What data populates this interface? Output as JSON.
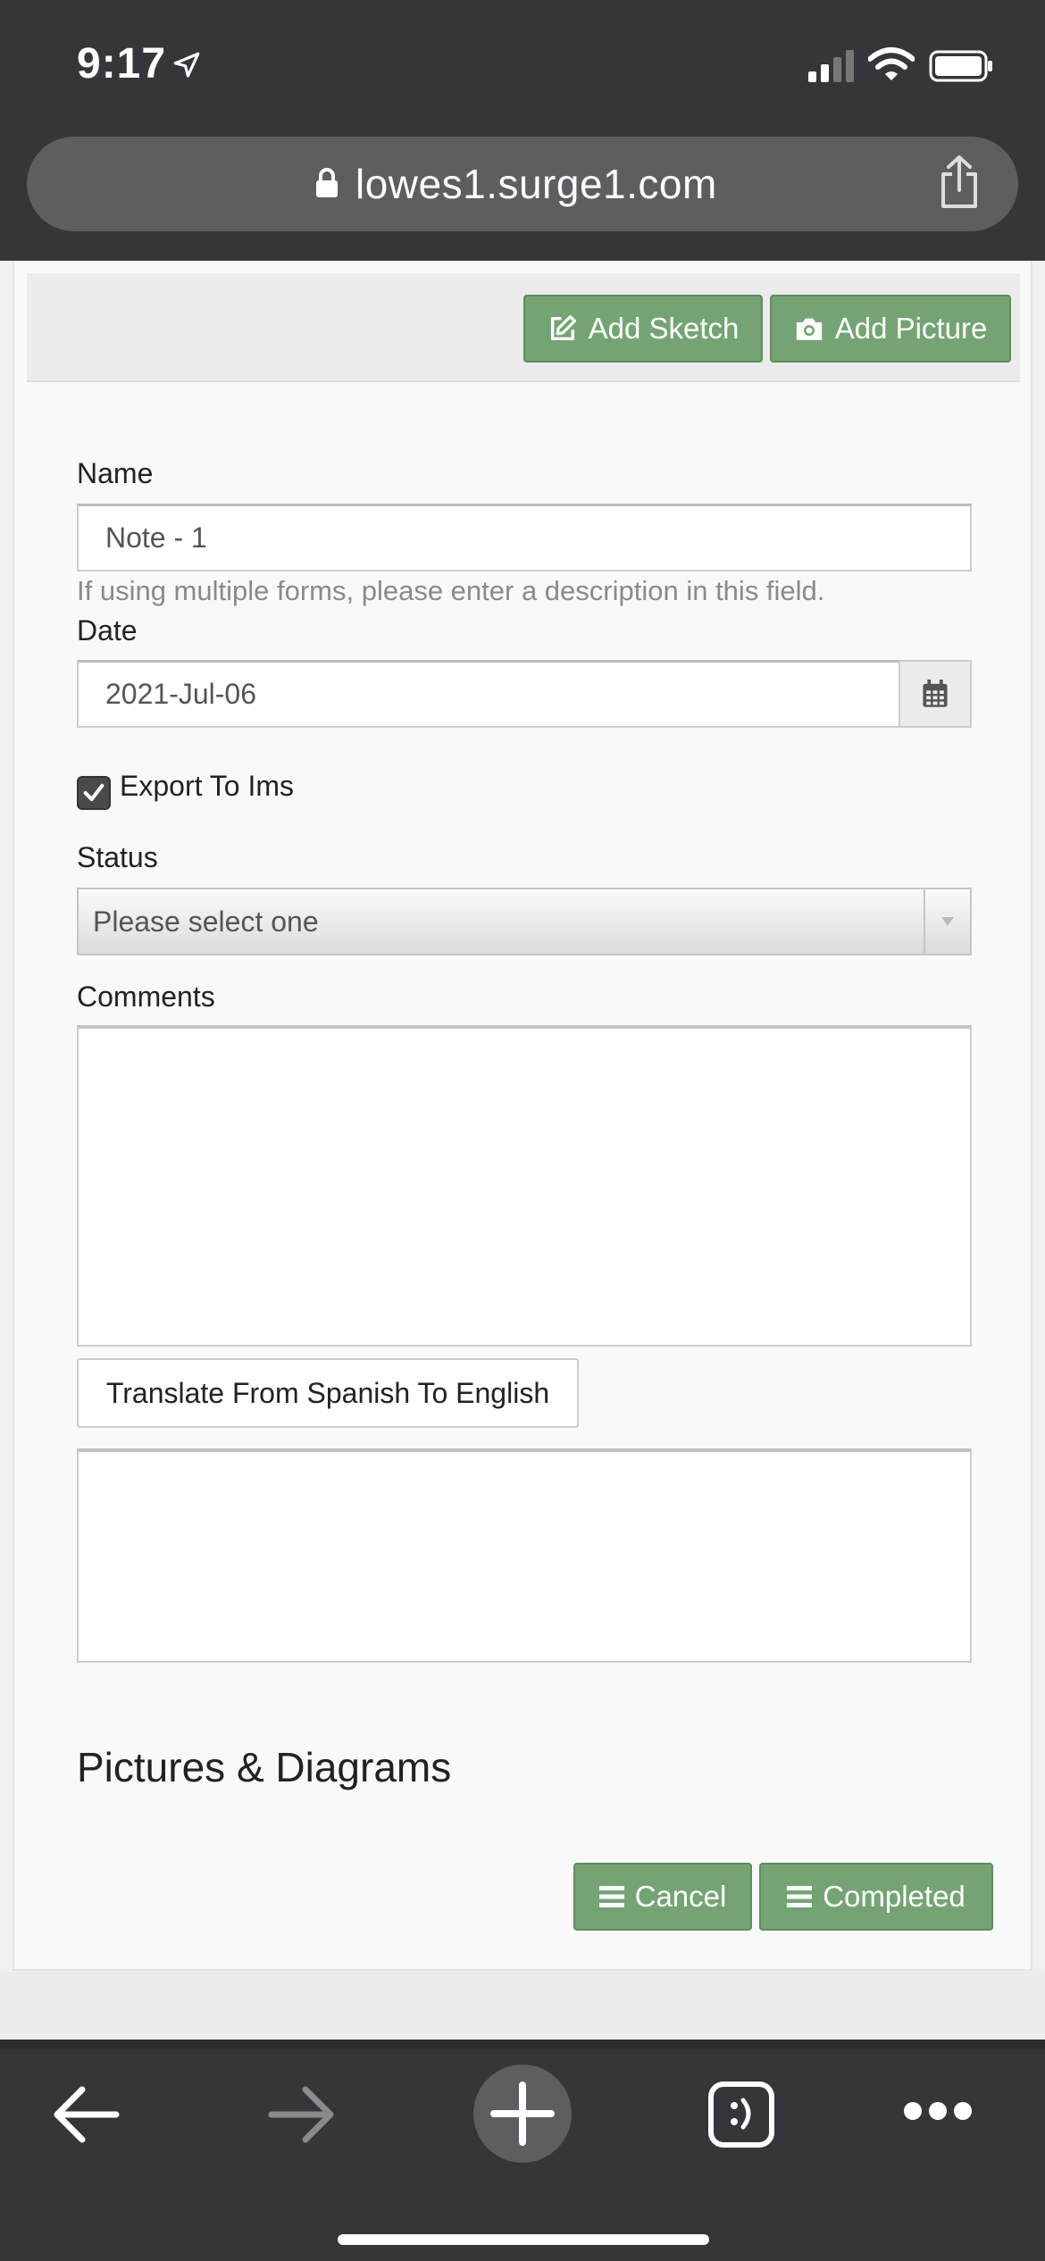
{
  "status_bar": {
    "time": "9:17"
  },
  "browser": {
    "url": "lowes1.surge1.com"
  },
  "toolbar": {
    "add_sketch": "Add Sketch",
    "add_picture": "Add Picture"
  },
  "form": {
    "name": {
      "label": "Name",
      "value": "Note - 1",
      "help": "If using multiple forms, please enter a description in this field."
    },
    "date": {
      "label": "Date",
      "value": "2021-Jul-06"
    },
    "export": {
      "label": "Export To Ims",
      "checked": true
    },
    "status": {
      "label": "Status",
      "selected": "Please select one"
    },
    "comments": {
      "label": "Comments",
      "value": ""
    },
    "translate_button": "Translate From Spanish To English",
    "translation": {
      "value": ""
    }
  },
  "pictures": {
    "title": "Pictures & Diagrams"
  },
  "actions": {
    "cancel": "Cancel",
    "completed": "Completed"
  },
  "icons": {
    "location": "location-arrow-icon",
    "signal": "cellular-signal-icon",
    "wifi": "wifi-icon",
    "battery": "battery-icon",
    "lock": "lock-icon",
    "share": "share-icon",
    "edit": "edit-icon",
    "camera": "camera-icon",
    "calendar": "calendar-icon",
    "list": "list-icon",
    "back": "back-arrow-icon",
    "forward": "forward-arrow-icon",
    "new_tab": "plus-icon",
    "tabs": "tabs-icon",
    "more": "more-icon"
  },
  "colors": {
    "button_green": "#75a474",
    "chrome_dark": "#343638"
  }
}
